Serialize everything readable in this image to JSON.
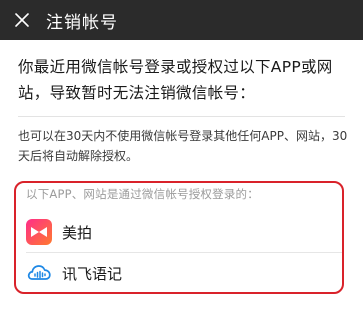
{
  "header": {
    "title": "注销帐号",
    "close_icon": "close-icon"
  },
  "content": {
    "headline": "你最近用微信帐号登录或授权过以下APP或网站，导致暂时无法注销微信帐号：",
    "note": "也可以在30天内不使用微信帐号登录其他任何APP、网站，30天后将自动解除授权。"
  },
  "apps": {
    "caption": "以下APP、网站是通过微信帐号授权登录的：",
    "items": [
      {
        "name": "美拍",
        "icon": "meipai-app-icon"
      },
      {
        "name": "讯飞语记",
        "icon": "xunfei-yuji-app-icon"
      }
    ]
  },
  "colors": {
    "navbar": "#2b2b2b",
    "highlight_border": "#d9222a",
    "meipai_gradient_start": "#ff2d8a",
    "meipai_gradient_end": "#ff7a2e",
    "xunfei_blue": "#1e88e5"
  }
}
